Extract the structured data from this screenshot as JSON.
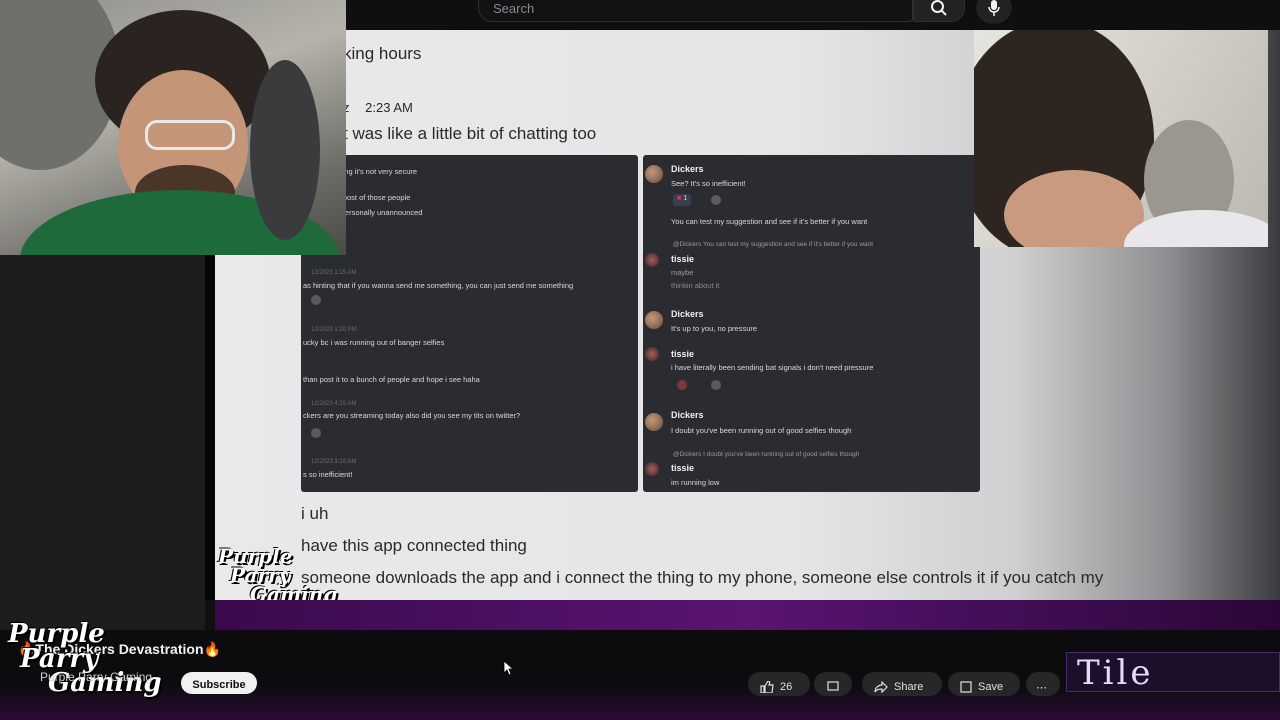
{
  "search": {
    "placeholder": "Search"
  },
  "document": {
    "line_top": "king hours",
    "timestamp_suffix": "z",
    "timestamp": "2:23 AM",
    "line_chatting": "t was like a little bit of chatting too",
    "line_uh": "i uh",
    "line_have": "have this app connected thing",
    "line_someone": "someone downloads the app and i connect the thing to my phone, someone else controls it if you catch my"
  },
  "left_chat": [
    "saying it's not very secure",
    "l most of those people",
    "l personally unannounced",
    "as hinting that if you wanna send me something, you can just send me something",
    "ucky bc i was running out of banger selfies",
    "than post it to a bunch of people and hope i see haha",
    "ckers are you streaming today also did you see my tits on twitter?",
    "s so inefficient!"
  ],
  "right_chat": {
    "user1": "Dickers",
    "user2": "tissie",
    "msg1": "See? It's so inefficient!",
    "msg2": "You can test my suggestion and see if it's better if you want",
    "reply1": "@Dickers You can test my suggestion and see if it's better if you want",
    "msg3": "maybe",
    "msg3b": "thinkin about it",
    "msg4": "It's up to you, no pressure",
    "msg5": "i have literally been sending bat signals i don't need pressure",
    "msg6": "I doubt you've been running out of good selfies though",
    "reply2": "@Dickers I doubt you've been running out of good selfies though",
    "msg7": "im running low",
    "reaction_count": "1"
  },
  "overlay_logo": {
    "line1": "Purple",
    "line2": "Parry",
    "line3": "Gaming"
  },
  "video": {
    "title": "🔥The Dickers Devastration🔥",
    "channel": "Purple Parry Gaming",
    "subscribe_label": "Subscribe",
    "like_count": "26",
    "share_label": "Share",
    "save_label": "Save"
  },
  "tile_logo": "Tile",
  "colors": {
    "purple": "#5a1472",
    "discord_bg": "#2b2c31",
    "subscribe_bg": "#f1f1f1"
  }
}
